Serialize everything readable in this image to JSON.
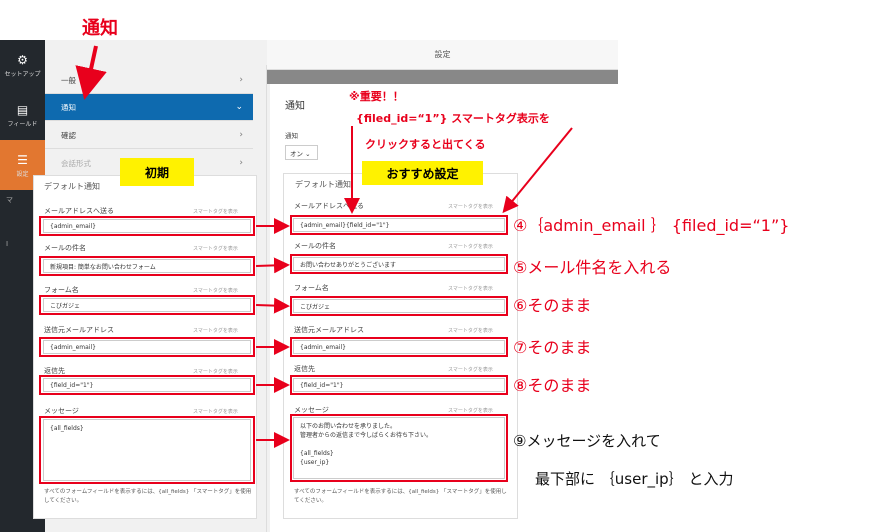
{
  "annotation_title": "通知",
  "sidebar": {
    "items": [
      {
        "icon": "gear-icon",
        "glyph": "⚙",
        "label": "セットアップ"
      },
      {
        "icon": "fields-icon",
        "glyph": "▤",
        "label": "フィールド"
      },
      {
        "icon": "settings-sliders-icon",
        "glyph": "☰",
        "label": "設定"
      }
    ],
    "extra": [
      "マ",
      "I"
    ]
  },
  "left": {
    "tabs": [
      {
        "label": "一般"
      },
      {
        "label": "通知"
      },
      {
        "label": "確認"
      },
      {
        "label": "会話形式"
      }
    ],
    "initial_label": "初期",
    "card_title": "デフォルト通知",
    "smart_tag": "スマートタグを表示",
    "fields": [
      {
        "label": "メールアドレスへ送る",
        "value": "{admin_email}"
      },
      {
        "label": "メールの件名",
        "value": "新規項目: 簡単なお問い合わせフォーム"
      },
      {
        "label": "フォーム名",
        "value": "こびガジェ"
      },
      {
        "label": "送信元メールアドレス",
        "value": "{admin_email}"
      },
      {
        "label": "返信先",
        "value": "{field_id=\"1\"}"
      }
    ],
    "message_label": "メッセージ",
    "message_value": "{all_fields}",
    "hint": "すべてのフォームフィールドを表示するには、{all_fields} 「スマートタグ」を使用してください。"
  },
  "right": {
    "top_title": "設定",
    "page_title": "通知",
    "notify_label": "通知",
    "notify_select": "オン ⌄",
    "recommend_label": "おすすめ設定",
    "card_title": "デフォルト通知",
    "smart_tag": "スマートタグを表示",
    "fields": [
      {
        "label": "メールアドレスへ送る",
        "value": "{admin_email}{field_id=\"1\"}"
      },
      {
        "label": "メールの件名",
        "value": "お問い合わせありがとうございます"
      },
      {
        "label": "フォーム名",
        "value": "こびガジェ"
      },
      {
        "label": "送信元メールアドレス",
        "value": "{admin_email}"
      },
      {
        "label": "返信先",
        "value": "{field_id=\"1\"}"
      }
    ],
    "message_label": "メッセージ",
    "message_value": "以下のお問い合わせを承りました。\n管理者からの返信まで今しばらくお待ち下さい。\n\n{all_fields}\n{user_ip}",
    "hint": "すべてのフォームフィールドを表示するには、{all_fields} 「スマートタグ」を使用してください。"
  },
  "notes": {
    "important": "※重要！！",
    "tag_line1": "{filed_id=“1”} スマートタグ表示を",
    "tag_line2": "クリックすると出てくる",
    "step4": "④｛admin_email ｝ {filed_id=“1”}",
    "step5": "⑤メール件名を入れる",
    "step6": "⑥そのまま",
    "step7": "⑦そのまま",
    "step8": "⑧そのまま",
    "step9": "⑨メッセージを入れて",
    "step9b": "最下部に ｛user_ip｝ と入力"
  },
  "colors": {
    "accent_red": "#e8001c",
    "active_blue": "#0e6aaf",
    "highlight_yellow": "#fff200",
    "sidebar_active": "#e27730"
  }
}
